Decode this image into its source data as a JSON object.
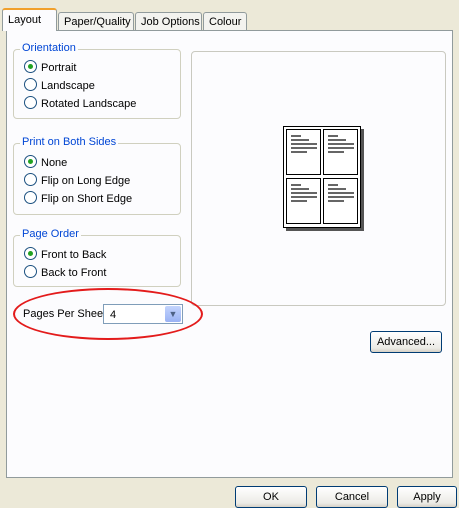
{
  "tabs": [
    "Layout",
    "Paper/Quality",
    "Job Options",
    "Colour"
  ],
  "orientation": {
    "title": "Orientation",
    "options": [
      "Portrait",
      "Landscape",
      "Rotated Landscape"
    ],
    "selected": "Portrait"
  },
  "print_both_sides": {
    "title": "Print on Both Sides",
    "options": [
      "None",
      "Flip on Long Edge",
      "Flip on Short Edge"
    ],
    "selected": "None"
  },
  "page_order": {
    "title": "Page Order",
    "options": [
      "Front to Back",
      "Back to Front"
    ],
    "selected": "Front to Back"
  },
  "pages_per_sheet": {
    "label": "Pages Per Sheet:",
    "value": "4"
  },
  "buttons": {
    "advanced": "Advanced...",
    "ok": "OK",
    "cancel": "Cancel",
    "apply": "Apply"
  },
  "colors": {
    "group_title": "#0046d5",
    "highlight": "#e31b1b",
    "selected_radio": "#21a121"
  }
}
